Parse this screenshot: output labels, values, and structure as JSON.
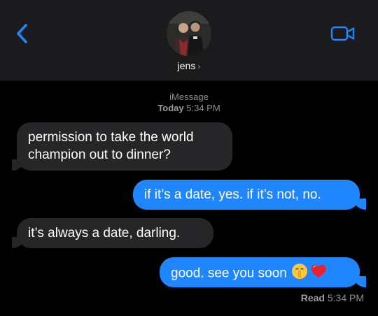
{
  "header": {
    "contact_name": "jens",
    "chevron": "›",
    "back_icon": "chevron-left-icon",
    "video_icon": "video-camera-icon",
    "accent": "#1f86ff"
  },
  "thread": {
    "service": "iMessage",
    "day": "Today",
    "time": "5:34 PM"
  },
  "messages": [
    {
      "direction": "incoming",
      "lines": [
        "permission to take the world",
        "champion out to dinner?"
      ]
    },
    {
      "direction": "outgoing",
      "text": "if it’s a date, yes. if it’s not, no."
    },
    {
      "direction": "incoming",
      "text": "it’s always a date, darling."
    },
    {
      "direction": "outgoing",
      "text": "good. see you soon",
      "emojis": [
        "shushing-face-icon",
        "red-heart-icon"
      ]
    }
  ],
  "receipt": {
    "label": "Read",
    "time": "5:34 PM"
  },
  "colors": {
    "incoming_bubble": "#262628",
    "outgoing_bubble": "#1f86ff",
    "header_bg": "#1b1b1d",
    "meta_text": "#8e8e93"
  }
}
